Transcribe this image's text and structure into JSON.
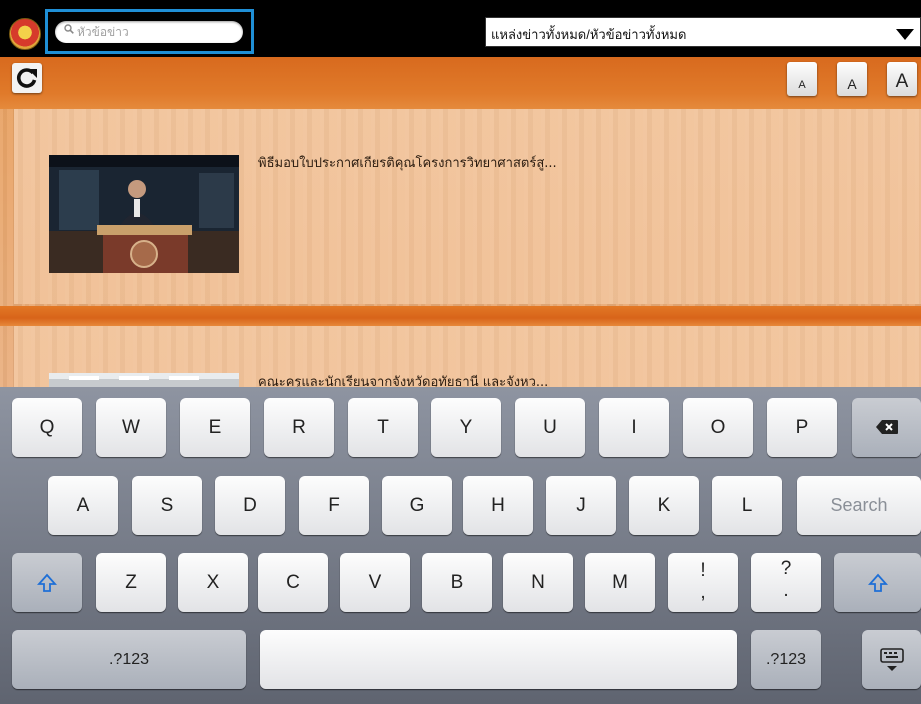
{
  "header": {
    "search": {
      "placeholder": "หัวข้อข่าว",
      "value": ""
    },
    "source_filter": {
      "selected": "แหล่งข่าวทั้งหมด/หัวข้อข่าวทั้งหมด"
    }
  },
  "toolbar": {
    "font_sizes": [
      "A",
      "A",
      "A"
    ]
  },
  "news": [
    {
      "title": "พิธีมอบใบประกาศเกียรติคุณโครงการวิทยาศาสตร์สู..."
    },
    {
      "title": "คณะครูและนักเรียนจากจังหวัดอุทัยธานี และจังหว..."
    }
  ],
  "keyboard": {
    "row1": [
      "Q",
      "W",
      "E",
      "R",
      "T",
      "Y",
      "U",
      "I",
      "O",
      "P"
    ],
    "row2": [
      "A",
      "S",
      "D",
      "F",
      "G",
      "H",
      "J",
      "K",
      "L"
    ],
    "search_key": "Search",
    "row3": [
      "Z",
      "X",
      "C",
      "V",
      "B",
      "N",
      "M"
    ],
    "punct1": [
      "!",
      ","
    ],
    "punct2": [
      "?",
      "."
    ],
    "numbers_key": ".?123"
  },
  "colors": {
    "highlight": "#1f8fd6",
    "wood": "#e8a160",
    "band": "#d86a1e"
  },
  "icons": [
    "app-logo-icon",
    "search-icon",
    "refresh-icon",
    "dropdown-caret-icon",
    "shift-icon",
    "backspace-icon",
    "hide-keyboard-icon"
  ]
}
